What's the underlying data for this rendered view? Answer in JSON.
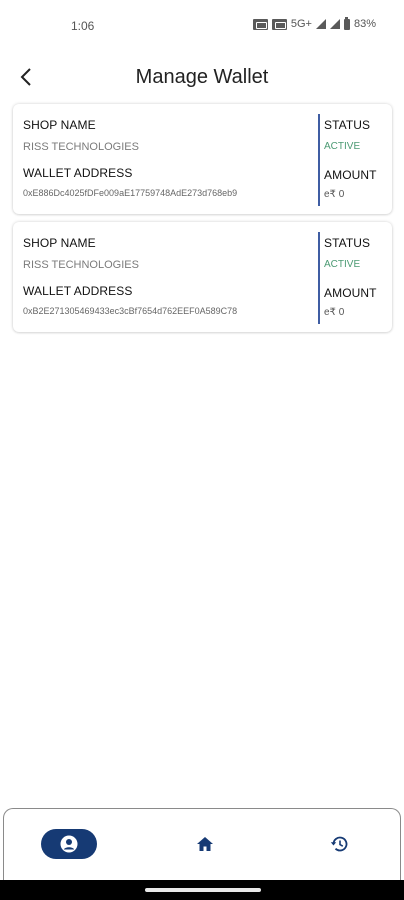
{
  "status_bar": {
    "time": "1:06",
    "network": "5G+",
    "battery": "83%"
  },
  "header": {
    "title": "Manage Wallet",
    "back_icon": "chevron-left-icon"
  },
  "wallets": [
    {
      "shop_name_label": "SHOP NAME",
      "shop_name": "RISS TECHNOLOGIES",
      "wallet_address_label": "WALLET ADDRESS",
      "wallet_address": "0xE886Dc4025fDFe009aE17759748AdE273d768eb9",
      "status_label": "STATUS",
      "status": "ACTIVE",
      "amount_label": "AMOUNT",
      "amount": "e₹ 0"
    },
    {
      "shop_name_label": "SHOP NAME",
      "shop_name": "RISS TECHNOLOGIES",
      "wallet_address_label": "WALLET ADDRESS",
      "wallet_address": "0xB2E271305469433ec3cBf7654d762EEF0A589C78",
      "status_label": "STATUS",
      "status": "ACTIVE",
      "amount_label": "AMOUNT",
      "amount": "e₹ 0"
    }
  ],
  "bottom_nav": {
    "items": [
      {
        "icon": "profile-icon",
        "active": true
      },
      {
        "icon": "home-icon",
        "active": false
      },
      {
        "icon": "history-icon",
        "active": false
      }
    ]
  },
  "colors": {
    "accent": "#163a74",
    "divider": "#3f5da3",
    "status_active": "#4b9a73"
  }
}
